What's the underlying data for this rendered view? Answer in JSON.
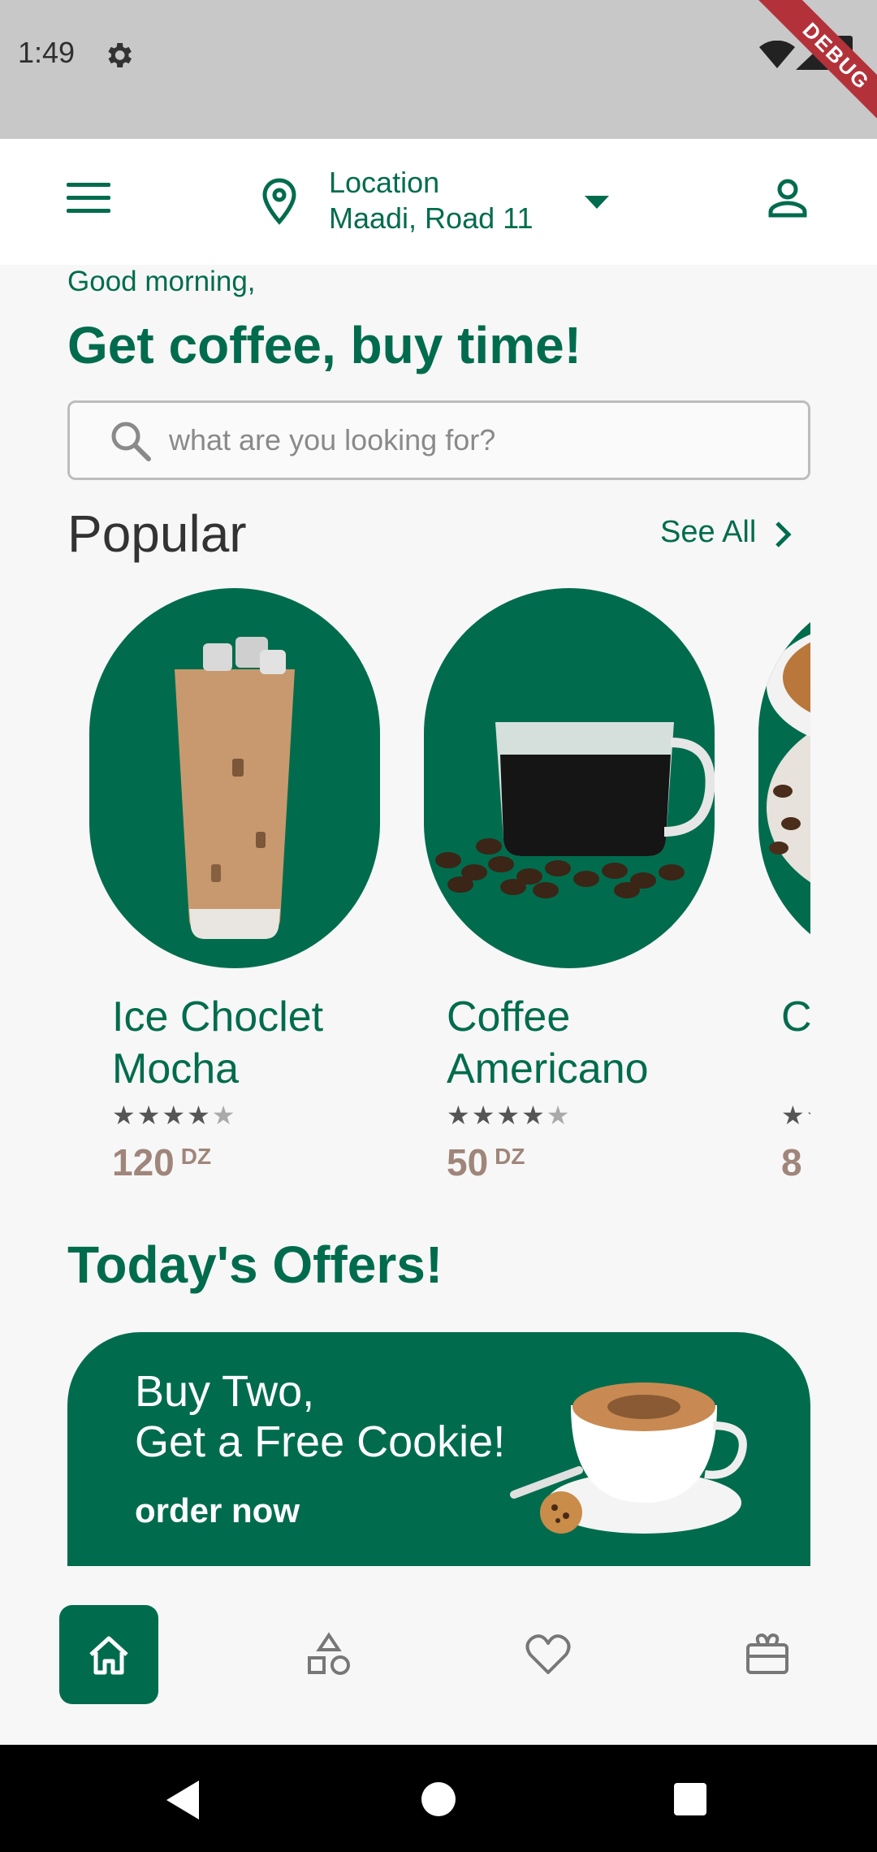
{
  "status_bar": {
    "time": "1:49",
    "debug_label": "DEBUG"
  },
  "header": {
    "location_label": "Location",
    "location_value": "Maadi, Road 11"
  },
  "greeting": "Good morning,",
  "headline": "Get coffee, buy time!",
  "search": {
    "placeholder": "what are you looking for?"
  },
  "popular": {
    "title": "Popular",
    "see_all": "See All",
    "items": [
      {
        "name": "Ice Choclet Mocha",
        "rating": 4,
        "price": "120",
        "currency": "DZ"
      },
      {
        "name": "Coffee Americano",
        "rating": 4,
        "price": "50",
        "currency": "DZ"
      },
      {
        "name": "C C",
        "rating": 1,
        "price": "8",
        "currency": ""
      }
    ]
  },
  "offers": {
    "title": "Today's Offers!",
    "line1": "Buy Two,",
    "line2": "Get a Free Cookie!",
    "cta": "order now"
  },
  "bottom_nav": [
    "home-icon",
    "categories-icon",
    "heart-icon",
    "gift-icon"
  ],
  "colors": {
    "primary": "#006c4d",
    "price": "#a0857a",
    "background": "#f7f7f7"
  }
}
